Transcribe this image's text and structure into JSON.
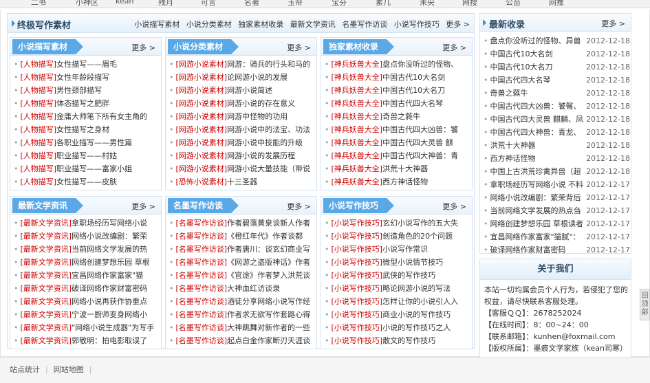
{
  "top_nav": [
    "二书",
    "小神区",
    "kean",
    "残月",
    "可言",
    "名著",
    "玉帝",
    "宝芬",
    "素几",
    "未央",
    "网搜",
    "公苗",
    "网推"
  ],
  "main_section": {
    "title": "终极写作素材",
    "links": [
      "小说描写素材",
      "小说分类素材",
      "独家素材收录",
      "最新文学资讯",
      "名墨写作访谈",
      "小说写作技巧",
      "更多 >"
    ]
  },
  "panels": [
    {
      "title": "小说描写素材",
      "more": "更多 >",
      "items": [
        {
          "tag": "[人物描写]",
          "text": "女性描写——眉毛"
        },
        {
          "tag": "[人物描写]",
          "text": "女性年龄段描写"
        },
        {
          "tag": "[人物描写]",
          "text": "男性颈部描写"
        },
        {
          "tag": "[人物描写]",
          "text": "体态描写之肥胖"
        },
        {
          "tag": "[人物描写]",
          "text": "金庸大师笔下所有女主角的"
        },
        {
          "tag": "[人物描写]",
          "text": "女性描写之身材"
        },
        {
          "tag": "[人物描写]",
          "text": "各职业描写——男性篇"
        },
        {
          "tag": "[人物描写]",
          "text": "职业描写——村姑"
        },
        {
          "tag": "[人物描写]",
          "text": "职业描写——富家小姐"
        },
        {
          "tag": "[人物描写]",
          "text": "女性描写——皮肤"
        }
      ]
    },
    {
      "title": "小说分类素材",
      "more": "更多 >",
      "items": [
        {
          "tag": "[网游小说素材]",
          "text": "网游：骑兵的行头和马的"
        },
        {
          "tag": "[网游小说素材]",
          "text": "论网游小说的发展"
        },
        {
          "tag": "[网游小说素材]",
          "text": "网游小说简述"
        },
        {
          "tag": "[网游小说素材]",
          "text": "网游小说的存在意义"
        },
        {
          "tag": "[网游小说素材]",
          "text": "网游中怪物的功用"
        },
        {
          "tag": "[网游小说素材]",
          "text": "网游小说中的法宝、功法"
        },
        {
          "tag": "[网游小说素材]",
          "text": "网游小说中技能的升级"
        },
        {
          "tag": "[网游小说素材]",
          "text": "网游小说的发展历程"
        },
        {
          "tag": "[网游小说素材]",
          "text": "网游小说大量技能（带说"
        },
        {
          "tag": "[恐怖小说素材]",
          "text": "十三圣器"
        }
      ]
    },
    {
      "title": "独家素材收录",
      "more": "更多 >",
      "items": [
        {
          "tag": "[神兵妖兽大全]",
          "text": "盘点你没听过的怪物、"
        },
        {
          "tag": "[神兵妖兽大全]",
          "text": "中国古代10大名剑"
        },
        {
          "tag": "[神兵妖兽大全]",
          "text": "中国古代10大名刀"
        },
        {
          "tag": "[神兵妖兽大全]",
          "text": "中国古代四大名琴"
        },
        {
          "tag": "[神兵妖兽大全]",
          "text": "奇兽之蕤牛"
        },
        {
          "tag": "[神兵妖兽大全]",
          "text": "中国古代四大凶兽：饕"
        },
        {
          "tag": "[神兵妖兽大全]",
          "text": "中国古代四大灵兽 麒"
        },
        {
          "tag": "[神兵妖兽大全]",
          "text": "中国古代四大神兽：青"
        },
        {
          "tag": "[神兵妖兽大全]",
          "text": "洪荒十大神器"
        },
        {
          "tag": "[神兵妖兽大全]",
          "text": "西方神话怪物"
        }
      ]
    },
    {
      "title": "最新文学资讯",
      "more": "更多 >",
      "items": [
        {
          "tag": "[最新文学资讯]",
          "text": "拿职场经历写网络小说"
        },
        {
          "tag": "[最新文学资讯]",
          "text": "网络小说改编剧：繁荣"
        },
        {
          "tag": "[最新文学资讯]",
          "text": "当前网络文学发展的热"
        },
        {
          "tag": "[最新文学资讯]",
          "text": "网络创建梦想乐园 草根"
        },
        {
          "tag": "[最新文学资讯]",
          "text": "宜昌网络作家富家\"猫"
        },
        {
          "tag": "[最新文学资讯]",
          "text": "破译网络作家财富密码"
        },
        {
          "tag": "[最新文学资讯]",
          "text": "网络小说再获作协重点"
        },
        {
          "tag": "[最新文学资讯]",
          "text": "宁波一厨师变身网络小"
        },
        {
          "tag": "[最新文学资讯]",
          "text": "\"网络小说生成器\"为写手"
        },
        {
          "tag": "[最新文学资讯]",
          "text": "郭敬明：拍电影取误了"
        }
      ]
    },
    {
      "title": "名墨写作访谈",
      "more": "更多 >",
      "items": [
        {
          "tag": "[名墨写作访谈]",
          "text": "作者碧落黄泉谈新人作者"
        },
        {
          "tag": "[名墨写作访谈]",
          "text": "《橙红年代》作者谈都"
        },
        {
          "tag": "[名墨写作访谈]",
          "text": "作者唐川：谈玄幻商业写"
        },
        {
          "tag": "[名墨写作访谈]",
          "text": "《网游之盗版神话》作者"
        },
        {
          "tag": "[名墨写作访谈]",
          "text": "《官途》作者梦入洪荒谈"
        },
        {
          "tag": "[名墨写作访谈]",
          "text": "大神血红访谈录"
        },
        {
          "tag": "[名墨写作访谈]",
          "text": "酒徒分享网络小说写作经"
        },
        {
          "tag": "[名墨写作访谈]",
          "text": "作者求无欲写作套路心得"
        },
        {
          "tag": "[名墨写作访谈]",
          "text": "大神跳舞对新作者的一些"
        },
        {
          "tag": "[名墨写作访谈]",
          "text": "起点白金作家断刃天涯谈"
        }
      ]
    },
    {
      "title": "小说写作技巧",
      "more": "更多 >",
      "items": [
        {
          "tag": "[小说写作技巧]",
          "text": "玄幻小说写作的五大失"
        },
        {
          "tag": "[小说写作技巧]",
          "text": "创造角色的20个问题"
        },
        {
          "tag": "[小说写作技巧]",
          "text": "小说写作常识"
        },
        {
          "tag": "[小说写作技巧]",
          "text": "微型小说情节技巧"
        },
        {
          "tag": "[小说写作技巧]",
          "text": "武侠的写作技巧"
        },
        {
          "tag": "[小说写作技巧]",
          "text": "略论网游小说的写法"
        },
        {
          "tag": "[小说写作技巧]",
          "text": "怎样让你的小说引人入"
        },
        {
          "tag": "[小说写作技巧]",
          "text": "商业小说的写作技巧"
        },
        {
          "tag": "[小说写作技巧]",
          "text": "小说的写作技巧之人"
        },
        {
          "tag": "[小说写作技巧]",
          "text": "散文的写作技巧"
        }
      ]
    }
  ],
  "latest": {
    "title": "最新收录",
    "more": "更多 >",
    "items": [
      {
        "text": "盘点你没听过的怪物、异兽",
        "date": "2012-12-18"
      },
      {
        "text": "中国古代10大名剑",
        "date": "2012-12-18"
      },
      {
        "text": "中国古代10大名刀",
        "date": "2012-12-18"
      },
      {
        "text": "中国古代四大名琴",
        "date": "2012-12-18"
      },
      {
        "text": "奇兽之蕤牛",
        "date": "2012-12-18"
      },
      {
        "text": "中国古代四大凶兽：饕餮、",
        "date": "2012-12-18"
      },
      {
        "text": "中国古代四大灵兽 麒麟、凤",
        "date": "2012-12-18"
      },
      {
        "text": "中国古代四大神兽：青龙、",
        "date": "2012-12-18"
      },
      {
        "text": "洪荒十大神器",
        "date": "2012-12-18"
      },
      {
        "text": "西方神话怪物",
        "date": "2012-12-18"
      },
      {
        "text": "中国上古洪荒珍禽异兽（超",
        "date": "2012-12-18"
      },
      {
        "text": "拿职场经历写网络小说 不料",
        "date": "2012-12-17"
      },
      {
        "text": "网络小说改编剧：繁荣背后",
        "date": "2012-12-17"
      },
      {
        "text": "当前网络文学发展的热点刍",
        "date": "2012-12-17"
      },
      {
        "text": "网络创建梦想乐园 草根读者",
        "date": "2012-12-17"
      },
      {
        "text": "宜昌网络作家富家\"猫腻\"：",
        "date": "2012-12-17"
      },
      {
        "text": "破译网络作家财富密码",
        "date": "2012-12-17"
      }
    ]
  },
  "about": {
    "title": "关于我们",
    "intro": "本站一切均属会员个人行为，若侵犯了您的权益，请尽快联系客服处理。",
    "qq": "【客服ＱＱ】：2678252024",
    "hours": "【在线时间】：8：00~24：00",
    "email": "【联系邮箱】：kunhen@foxmail.com",
    "copyright": "【版权所属】：墨痕文学家族（kean司寒）"
  },
  "footer": {
    "stats": "站点统计",
    "sitemap": "网站地图"
  },
  "back_to_top": "回顶部"
}
